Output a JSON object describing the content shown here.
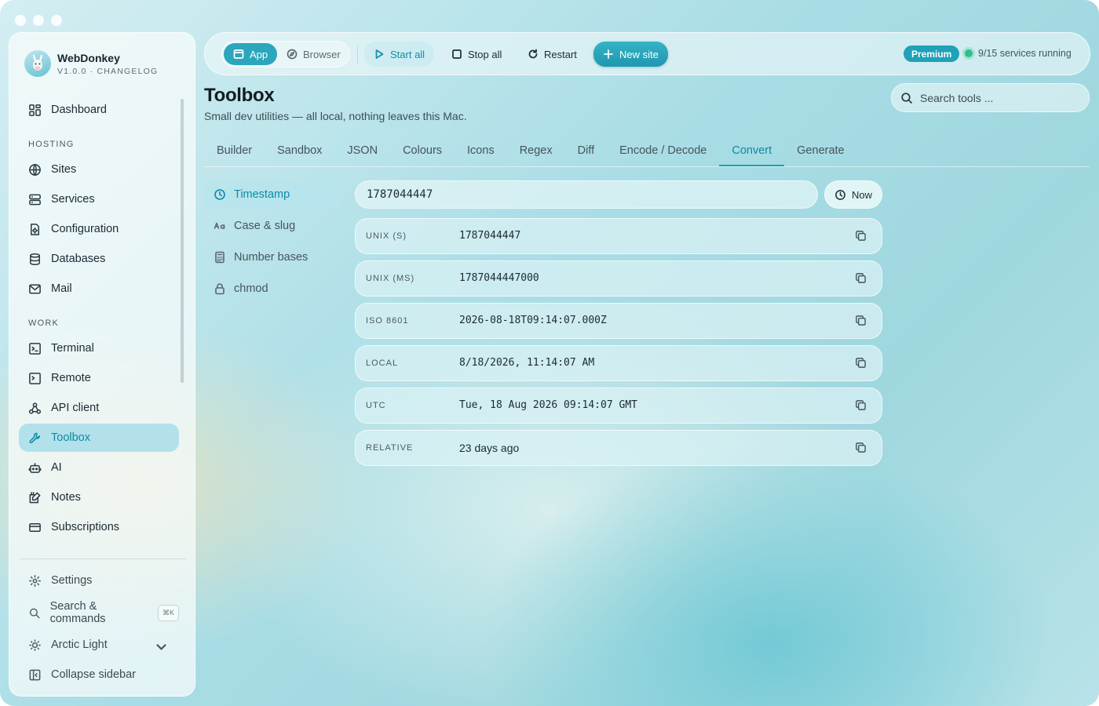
{
  "brand": {
    "name": "WebDonkey",
    "version": "V1.0.0 · CHANGELOG"
  },
  "sidebar": {
    "dashboard": "Dashboard",
    "hosting_label": "HOSTING",
    "hosting": [
      "Sites",
      "Services",
      "Configuration",
      "Databases",
      "Mail"
    ],
    "work_label": "WORK",
    "work": [
      "Terminal",
      "Remote",
      "API client",
      "Toolbox",
      "AI",
      "Notes",
      "Subscriptions"
    ],
    "active": "Toolbox",
    "footer": {
      "settings": "Settings",
      "search": "Search & commands",
      "search_kbd": "⌘K",
      "theme": "Arctic Light",
      "collapse": "Collapse sidebar"
    }
  },
  "toolbar": {
    "app": "App",
    "browser": "Browser",
    "start_all": "Start all",
    "stop_all": "Stop all",
    "restart": "Restart",
    "new_site": "New site",
    "premium": "Premium",
    "services_status": "9/15 services running"
  },
  "page": {
    "title": "Toolbox",
    "subtitle": "Small dev utilities — all local, nothing leaves this Mac.",
    "search_placeholder": "Search tools ..."
  },
  "tabs": [
    "Builder",
    "Sandbox",
    "JSON",
    "Colours",
    "Icons",
    "Regex",
    "Diff",
    "Encode / Decode",
    "Convert",
    "Generate"
  ],
  "active_tab": "Convert",
  "subnav": [
    "Timestamp",
    "Case & slug",
    "Number bases",
    "chmod"
  ],
  "converter": {
    "input_value": "1787044447",
    "now_label": "Now",
    "rows": [
      {
        "label": "UNIX (S)",
        "value": "1787044447"
      },
      {
        "label": "UNIX (MS)",
        "value": "1787044447000"
      },
      {
        "label": "ISO 8601",
        "value": "2026-08-18T09:14:07.000Z"
      },
      {
        "label": "LOCAL",
        "value": "8/18/2026, 11:14:07 AM"
      },
      {
        "label": "UTC",
        "value": "Tue, 18 Aug 2026 09:14:07 GMT"
      },
      {
        "label": "RELATIVE",
        "value": "23 days ago"
      }
    ]
  },
  "colors": {
    "accent": "#1aa0b8",
    "status_ok": "#2fbf8a"
  }
}
